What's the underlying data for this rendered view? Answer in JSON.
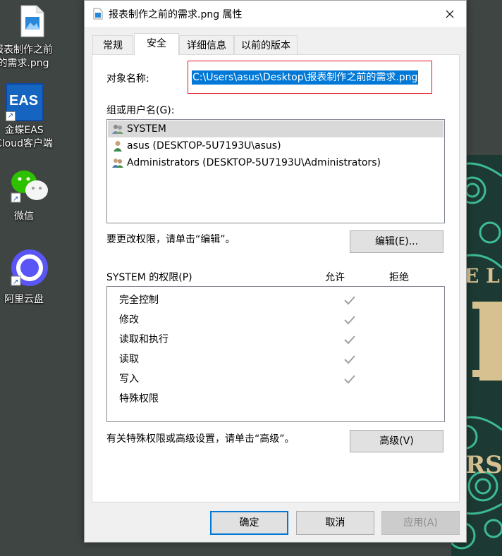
{
  "desktop": {
    "icons": [
      {
        "label": "报表制作之前\n的需求.png",
        "name": "desktop-file-png"
      },
      {
        "label": "金蝶EAS\nCloud客户端",
        "name": "desktop-eas-cloud"
      },
      {
        "label": "微信",
        "name": "desktop-wechat"
      },
      {
        "label": "阿里云盘",
        "name": "desktop-aliyun-drive"
      }
    ],
    "art_text": [
      "E L",
      "RS"
    ]
  },
  "dialog": {
    "title": "报表制作之前的需求.png 属性",
    "tabs": [
      {
        "label": "常规"
      },
      {
        "label": "安全"
      },
      {
        "label": "详细信息"
      },
      {
        "label": "以前的版本"
      }
    ],
    "object_name_label": "对象名称:",
    "object_name_value": "C:\\Users\\asus\\Desktop\\报表制作之前的需求.png",
    "groups_label": "组或用户名(G):",
    "users": [
      {
        "name": "SYSTEM"
      },
      {
        "name": "asus (DESKTOP-5U7193U\\asus)"
      },
      {
        "name": "Administrators (DESKTOP-5U7193U\\Administrators)"
      }
    ],
    "change_hint": "要更改权限，请单击“编辑”。",
    "edit_button": "编辑(E)...",
    "permissions_label": "SYSTEM 的权限(P)",
    "allow_header": "允许",
    "deny_header": "拒绝",
    "permissions": [
      {
        "name": "完全控制",
        "allow": true
      },
      {
        "name": "修改",
        "allow": true
      },
      {
        "name": "读取和执行",
        "allow": true
      },
      {
        "name": "读取",
        "allow": true
      },
      {
        "name": "写入",
        "allow": true
      },
      {
        "name": "特殊权限",
        "allow": false
      }
    ],
    "advanced_hint": "有关特殊权限或高级设置，请单击“高级”。",
    "advanced_button": "高级(V)",
    "ok_button": "确定",
    "cancel_button": "取消",
    "apply_button": "应用(A)"
  },
  "colors": {
    "selection": "#0078d7",
    "highlight_border": "#e81123",
    "check": "#a0a0a0"
  }
}
